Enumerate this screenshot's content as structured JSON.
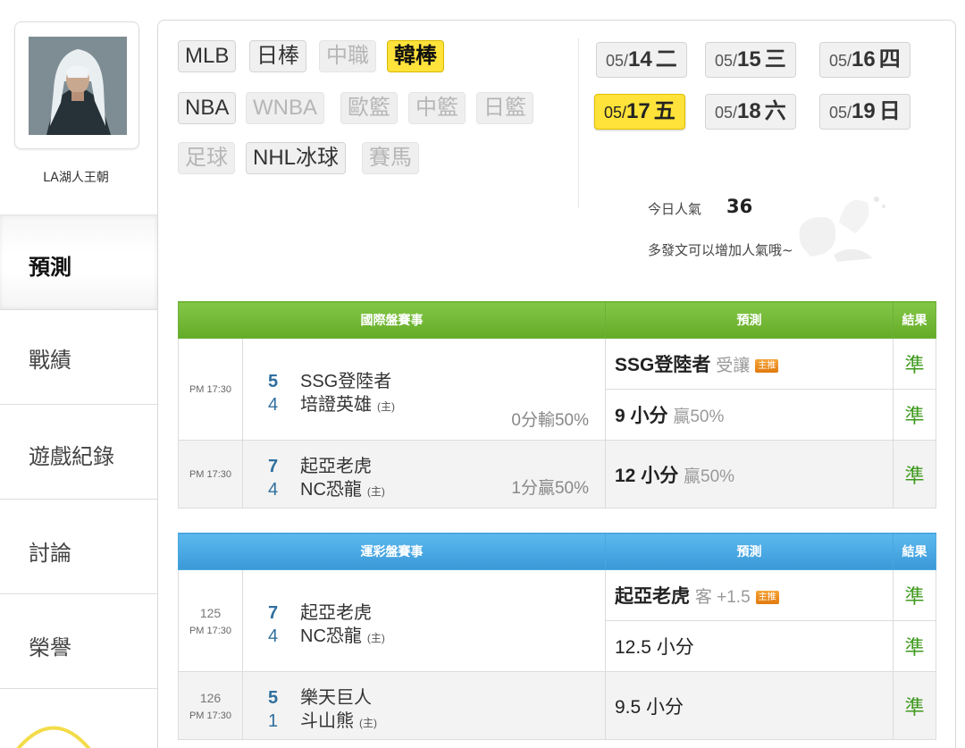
{
  "user": {
    "name": "LA湖人王朝"
  },
  "sidebar": {
    "items": [
      {
        "label": "預測",
        "active": true
      },
      {
        "label": "戰績"
      },
      {
        "label": "遊戲紀錄"
      },
      {
        "label": "討論"
      },
      {
        "label": "榮譽"
      }
    ]
  },
  "leagues": {
    "row1": [
      {
        "label": "MLB",
        "state": "normal"
      },
      {
        "label": "日棒",
        "state": "normal"
      },
      {
        "label": "中職",
        "state": "disabled"
      },
      {
        "label": "韓棒",
        "state": "active"
      }
    ],
    "row2": [
      {
        "label": "NBA",
        "state": "normal"
      },
      {
        "label": "WNBA",
        "state": "disabled"
      },
      {
        "label": "歐籃",
        "state": "disabled"
      },
      {
        "label": "中籃",
        "state": "disabled"
      },
      {
        "label": "日籃",
        "state": "disabled"
      }
    ],
    "row3": [
      {
        "label": "足球",
        "state": "disabled"
      },
      {
        "label": "NHL冰球",
        "state": "normal"
      },
      {
        "label": "賽馬",
        "state": "disabled"
      }
    ]
  },
  "dates": [
    {
      "md": "05/",
      "day": "14",
      "weekday": "二"
    },
    {
      "md": "05/",
      "day": "15",
      "weekday": "三"
    },
    {
      "md": "05/",
      "day": "16",
      "weekday": "四"
    },
    {
      "md": "05/",
      "day": "17",
      "weekday": "五",
      "active": true
    },
    {
      "md": "05/",
      "day": "18",
      "weekday": "六"
    },
    {
      "md": "05/",
      "day": "19",
      "weekday": "日"
    }
  ],
  "popularity": {
    "label": "今日人氣",
    "value": "36",
    "message": "多發文可以增加人氣哦~"
  },
  "international": {
    "headers": {
      "events": "國際盤賽事",
      "prediction": "預測",
      "result": "結果"
    },
    "games": [
      {
        "time": "PM 17:30",
        "away_score": "5",
        "away_team": "SSG登陸者",
        "home_score": "4",
        "home_team": "培證英雄",
        "home_mark": "(主)",
        "odds": "0分輸50%",
        "predictions": [
          {
            "main": "SSG登陸者",
            "sub": "受讓",
            "badge": "主推",
            "result": "準"
          },
          {
            "main": "9 小分",
            "sub": "贏50%",
            "result": "準"
          }
        ]
      },
      {
        "time": "PM 17:30",
        "away_score": "7",
        "away_team": "起亞老虎",
        "home_score": "4",
        "home_team": "NC恐龍",
        "home_mark": "(主)",
        "odds": "1分贏50%",
        "predictions": [
          {
            "main": "12 小分",
            "sub": "贏50%",
            "result": "準"
          }
        ]
      }
    ]
  },
  "sports_lottery": {
    "headers": {
      "events": "運彩盤賽事",
      "prediction": "預測",
      "result": "結果"
    },
    "games": [
      {
        "number": "125",
        "time": "PM 17:30",
        "away_score": "7",
        "away_team": "起亞老虎",
        "home_score": "4",
        "home_team": "NC恐龍",
        "home_mark": "(主)",
        "predictions": [
          {
            "main": "起亞老虎",
            "sub": "客 +1.5",
            "badge": "主推",
            "result": "準"
          },
          {
            "main": "12.5 小分",
            "result": "準"
          }
        ]
      },
      {
        "number": "126",
        "time": "PM 17:30",
        "away_score": "5",
        "away_team": "樂天巨人",
        "home_score": "1",
        "home_team": "斗山熊",
        "home_mark": "(主)",
        "predictions": [
          {
            "main": "9.5 小分",
            "result": "準"
          }
        ]
      }
    ]
  }
}
